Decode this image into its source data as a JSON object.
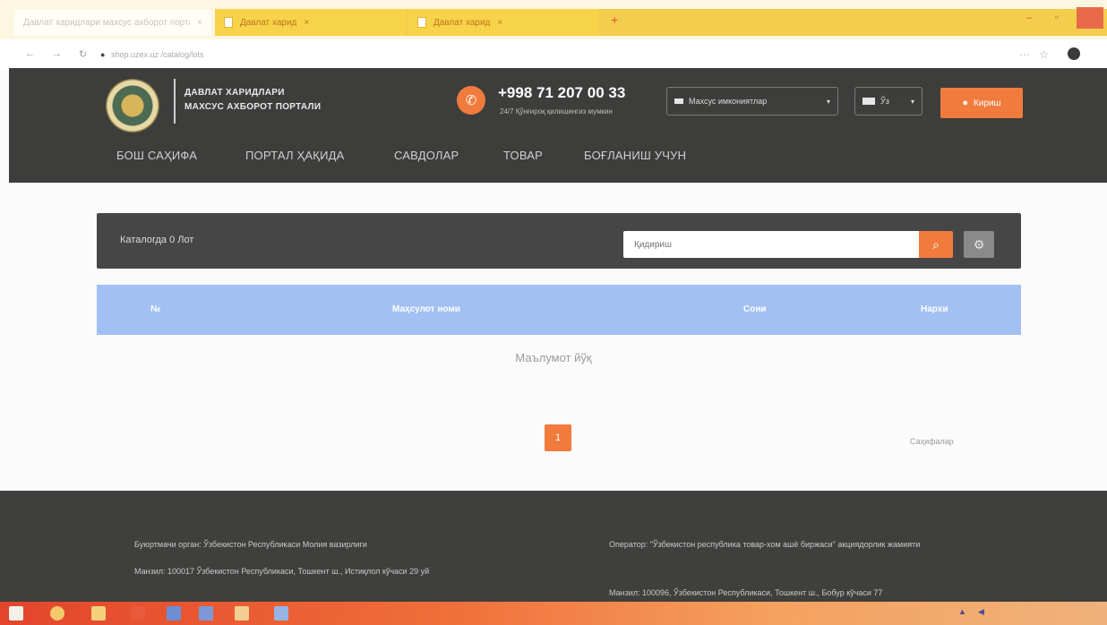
{
  "browser": {
    "tabs": [
      {
        "title": "Давлат харидлари махсус ахборот портали"
      },
      {
        "title": "Давлат харид"
      },
      {
        "title": "Давлат харид"
      }
    ],
    "new_tab_label": "+",
    "url": "shop.uzex.uz",
    "url_path": "/catalog/lots",
    "window_controls": {
      "minimize": "–",
      "maximize": "▫"
    }
  },
  "site": {
    "brand_line1": "ДАВЛАТ ХАРИДЛАРИ",
    "brand_line2": "МАХСУС АХБОРОТ ПОРТАЛИ",
    "phone": "+998 71 207 00 33",
    "phone_sub": "24/7 Қўнғироқ қилишингиз мумкин",
    "lang_group_label": "Махсус имкониятлар",
    "lang_label": "Ўз",
    "login_label": "Кириш",
    "nav": [
      "БОШ САҲИФА",
      "ПОРТАЛ ҲАҚИДА",
      "САВДОЛАР",
      "ТОВАР",
      "БОҒЛАНИШ УЧУН"
    ]
  },
  "catalog": {
    "title": "Каталогда 0 Лот",
    "search_placeholder": "Қидириш",
    "columns": [
      "№",
      "Маҳсулот номи",
      "Сони",
      "Нархи"
    ],
    "empty_message": "Маълумот йўқ",
    "current_page": "1",
    "page_count_label": "Саҳифалар"
  },
  "footer": {
    "customer_org": "Буюртмачи орган: Ўзбекистон Республикаси Молия вазирлиги",
    "customer_address": "Манзил: 100017 Ўзбекистон Республикаси, Тошкент ш., Истиқлол кўчаси 29 уй",
    "operator": "Оператор: \"Ўзбекистон республика товар-хом ашё биржаси\" акциядорлик жамияти",
    "operator_address": "Манзил: 100096, Ўзбекистон Республикаси, Тошкент ш., Бобур кўчаси 77"
  }
}
